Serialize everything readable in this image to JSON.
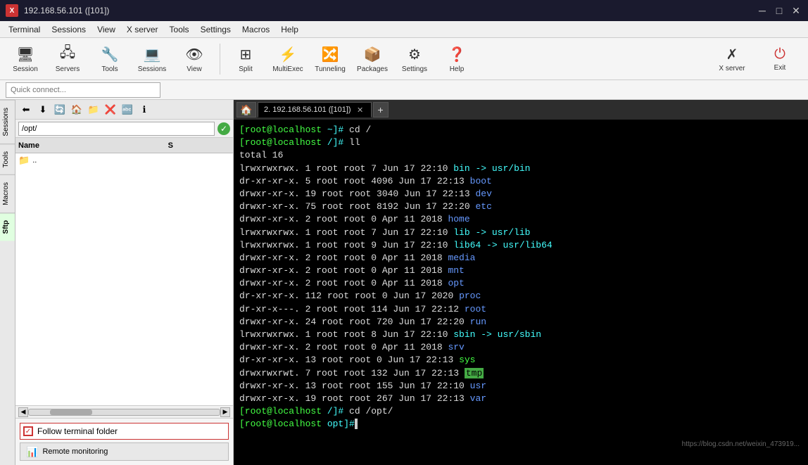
{
  "titlebar": {
    "title": "192.168.56.101 ([101])",
    "icon_text": "X",
    "min_btn": "─",
    "max_btn": "□",
    "close_btn": "✕"
  },
  "menubar": {
    "items": [
      "Terminal",
      "Sessions",
      "View",
      "X server",
      "Tools",
      "Settings",
      "Macros",
      "Help"
    ]
  },
  "toolbar": {
    "buttons": [
      {
        "label": "Session",
        "icon": "🖥"
      },
      {
        "label": "Servers",
        "icon": "⚙"
      },
      {
        "label": "Tools",
        "icon": "🔧"
      },
      {
        "label": "Sessions",
        "icon": "💻"
      },
      {
        "label": "View",
        "icon": "👁"
      },
      {
        "label": "Split",
        "icon": "⊞"
      },
      {
        "label": "MultiExec",
        "icon": "⚡"
      },
      {
        "label": "Tunneling",
        "icon": "🔀"
      },
      {
        "label": "Packages",
        "icon": "📦"
      },
      {
        "label": "Settings",
        "icon": "⚙"
      },
      {
        "label": "Help",
        "icon": "❓"
      }
    ],
    "xserver_label": "X server",
    "exit_label": "Exit"
  },
  "quickconnect": {
    "placeholder": "Quick connect..."
  },
  "sidebar": {
    "path": "/opt/",
    "columns": {
      "name": "Name",
      "size": "S"
    },
    "files": [
      {
        "name": "..",
        "icon": "📁",
        "is_parent": true
      }
    ],
    "follow_terminal": "Follow terminal folder",
    "remote_monitoring": "Remote monitoring",
    "vtabs": [
      "Sessions",
      "Tools",
      "Macros",
      "Sftp"
    ]
  },
  "terminal": {
    "tab_label": "2. 192.168.56.101 ([101])",
    "home_icon": "🏠",
    "lines": [
      {
        "type": "command",
        "prompt_user": "[root@localhost",
        "prompt_path": "~]#",
        "cmd": " cd /"
      },
      {
        "type": "command",
        "prompt_user": "[root@localhost",
        "prompt_path": "/]#",
        "cmd": " ll"
      },
      {
        "type": "output",
        "text": "total 16"
      },
      {
        "type": "listing",
        "perms": "lrwxrwxrwx.",
        "links": " 1",
        "user": " root",
        "group": " root",
        "size": "      7",
        "date": " Jun 17 22:10",
        "name": " bin",
        "arrow": " -> usr/bin",
        "name_color": "cyan",
        "arrow_color": "cyan"
      },
      {
        "type": "listing",
        "perms": "dr-xr-xr-x.",
        "links": " 5",
        "user": " root",
        "group": " root",
        "size": "   4096",
        "date": " Jun 17 22:13",
        "name": " boot",
        "arrow": "",
        "name_color": "blue",
        "arrow_color": ""
      },
      {
        "type": "listing",
        "perms": "drwxr-xr-x.",
        "links": "19",
        "user": " root",
        "group": " root",
        "size": "   3040",
        "date": " Jun 17 22:13",
        "name": " dev",
        "arrow": "",
        "name_color": "blue",
        "arrow_color": ""
      },
      {
        "type": "listing",
        "perms": "drwxr-xr-x.",
        "links": "75",
        "user": " root",
        "group": " root",
        "size": "   8192",
        "date": " Jun 17 22:20",
        "name": " etc",
        "arrow": "",
        "name_color": "blue",
        "arrow_color": ""
      },
      {
        "type": "listing",
        "perms": "drwxr-xr-x.",
        "links": " 2",
        "user": " root",
        "group": " root",
        "size": "      0",
        "date": " Apr 11  2018",
        "name": " home",
        "arrow": "",
        "name_color": "blue",
        "arrow_color": ""
      },
      {
        "type": "listing",
        "perms": "lrwxrwxrwx.",
        "links": " 1",
        "user": " root",
        "group": " root",
        "size": "      7",
        "date": " Jun 17 22:10",
        "name": " lib",
        "arrow": " -> usr/lib",
        "name_color": "cyan",
        "arrow_color": "cyan"
      },
      {
        "type": "listing",
        "perms": "lrwxrwxrwx.",
        "links": " 1",
        "user": " root",
        "group": " root",
        "size": "      9",
        "date": " Jun 17 22:10",
        "name": " lib64",
        "arrow": " -> usr/lib64",
        "name_color": "cyan",
        "arrow_color": "cyan"
      },
      {
        "type": "listing",
        "perms": "drwxr-xr-x.",
        "links": " 2",
        "user": " root",
        "group": " root",
        "size": "      0",
        "date": " Apr 11  2018",
        "name": " media",
        "arrow": "",
        "name_color": "blue",
        "arrow_color": ""
      },
      {
        "type": "listing",
        "perms": "drwxr-xr-x.",
        "links": " 2",
        "user": " root",
        "group": " root",
        "size": "      0",
        "date": " Apr 11  2018",
        "name": " mnt",
        "arrow": "",
        "name_color": "blue",
        "arrow_color": ""
      },
      {
        "type": "listing",
        "perms": "drwxr-xr-x.",
        "links": " 2",
        "user": " root",
        "group": " root",
        "size": "      0",
        "date": " Apr 11  2018",
        "name": " opt",
        "arrow": "",
        "name_color": "blue",
        "arrow_color": ""
      },
      {
        "type": "listing",
        "perms": "dr-xr-xr-x.",
        "links": "112",
        "user": " root",
        "group": " root",
        "size": "      0",
        "date": " Jun 17  2020",
        "name": " proc",
        "arrow": "",
        "name_color": "blue",
        "arrow_color": ""
      },
      {
        "type": "listing",
        "perms": "dr-xr-x---.",
        "links": "  2",
        "user": " root",
        "group": " root",
        "size": "    114",
        "date": " Jun 17 22:12",
        "name": " root",
        "arrow": "",
        "name_color": "blue",
        "arrow_color": ""
      },
      {
        "type": "listing",
        "perms": "drwxr-xr-x.",
        "links": "24",
        "user": " root",
        "group": " root",
        "size": "    720",
        "date": " Jun 17 22:20",
        "name": " run",
        "arrow": "",
        "name_color": "blue",
        "arrow_color": ""
      },
      {
        "type": "listing",
        "perms": "lrwxrwxrwx.",
        "links": " 1",
        "user": " root",
        "group": " root",
        "size": "      8",
        "date": " Jun 17 22:10",
        "name": " sbin",
        "arrow": " -> usr/sbin",
        "name_color": "cyan",
        "arrow_color": "cyan"
      },
      {
        "type": "listing",
        "perms": "drwxr-xr-x.",
        "links": " 2",
        "user": " root",
        "group": " root",
        "size": "      0",
        "date": " Apr 11  2018",
        "name": " srv",
        "arrow": "",
        "name_color": "blue",
        "arrow_color": ""
      },
      {
        "type": "listing",
        "perms": "dr-xr-xr-x.",
        "links": "13",
        "user": " root",
        "group": " root",
        "size": "      0",
        "date": " Jun 17 22:13",
        "name": " sys",
        "arrow": "",
        "name_color": "green",
        "arrow_color": ""
      },
      {
        "type": "listing",
        "perms": "drwxrwxrwt.",
        "links": " 7",
        "user": " root",
        "group": " root",
        "size": "    132",
        "date": " Jun 17 22:13",
        "name": " tmp",
        "arrow": "",
        "name_color": "highlight_green",
        "arrow_color": ""
      },
      {
        "type": "listing",
        "perms": "drwxr-xr-x.",
        "links": "13",
        "user": " root",
        "group": " root",
        "size": "    155",
        "date": " Jun 17 22:10",
        "name": " usr",
        "arrow": "",
        "name_color": "blue",
        "arrow_color": ""
      },
      {
        "type": "listing",
        "perms": "drwxr-xr-x.",
        "links": "19",
        "user": " root",
        "group": " root",
        "size": "    267",
        "date": " Jun 17 22:13",
        "name": " var",
        "arrow": "",
        "name_color": "blue",
        "arrow_color": ""
      },
      {
        "type": "command",
        "prompt_user": "[root@localhost",
        "prompt_path": "/]#",
        "cmd": " cd /opt/"
      },
      {
        "type": "prompt_only",
        "prompt_user": "[root@localhost",
        "prompt_path": "opt]#",
        "cursor": true
      }
    ]
  },
  "statusbar": {
    "watermark": "https://blog.csdn.net/weixin_473919..."
  }
}
